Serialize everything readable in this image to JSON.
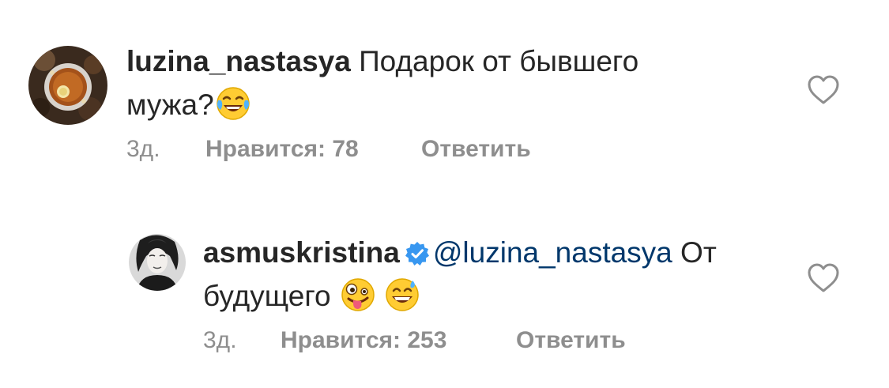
{
  "comments": [
    {
      "username": "luzina_nastasya",
      "verified": false,
      "mention": "",
      "text_line1": " Подарок от бывшего",
      "text_line2": "мужа?",
      "emojis": [
        "face-with-tears-of-joy"
      ],
      "time": "3д.",
      "likes_text": "Нравится: 78",
      "reply_label": "Ответить",
      "avatar": "tea-cup-avatar"
    },
    {
      "username": "asmuskristina",
      "verified": true,
      "mention": "@luzina_nastasya",
      "text_line1": " От",
      "text_line2": "будущего",
      "emojis": [
        "zany-face",
        "grinning-face-with-sweat"
      ],
      "time": "3д.",
      "likes_text": "Нравится: 253",
      "reply_label": "Ответить",
      "avatar": "woman-portrait-avatar"
    }
  ],
  "colors": {
    "text": "#262626",
    "meta": "#8e8e8e",
    "mention": "#00376b",
    "verified": "#3897f0"
  }
}
